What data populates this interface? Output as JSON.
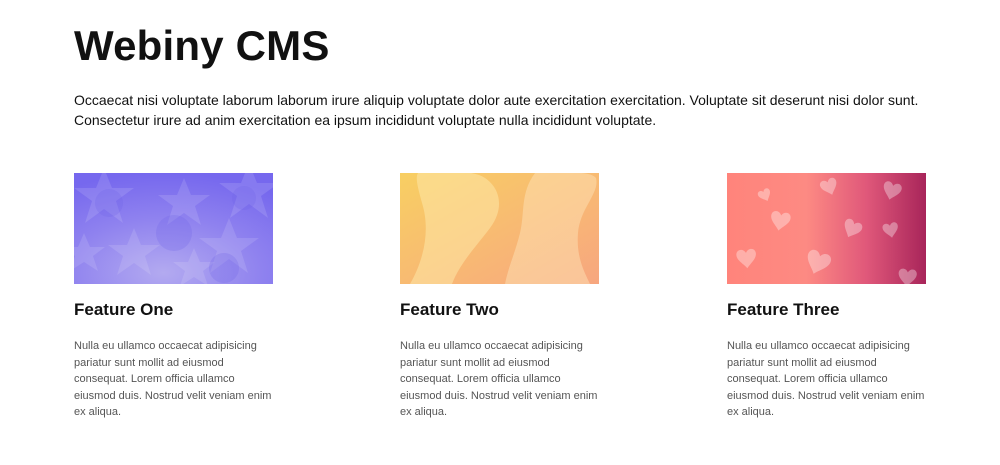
{
  "page": {
    "title": "Webiny CMS",
    "intro": "Occaecat nisi voluptate laborum laborum irure aliquip voluptate dolor aute exercitation exercitation. Voluptate sit deserunt nisi dolor sunt. Consectetur irure ad anim exercitation ea ipsum incididunt voluptate nulla incididunt voluptate."
  },
  "features": [
    {
      "title": "Feature One",
      "text": "Nulla eu ullamco occaecat adipisicing pariatur sunt mollit ad eiusmod consequat. Lorem officia ullamco eiusmod duis. Nostrud velit veniam enim ex aliqua.",
      "image": "stars-pattern-image",
      "colors": [
        "#7b6ef0",
        "#9d90f0"
      ]
    },
    {
      "title": "Feature Two",
      "text": "Nulla eu ullamco occaecat adipisicing pariatur sunt mollit ad eiusmod consequat. Lorem officia ullamco eiusmod duis. Nostrud velit veniam enim ex aliqua.",
      "image": "waves-pattern-image",
      "colors": [
        "#f7c95e",
        "#f8a97c"
      ]
    },
    {
      "title": "Feature Three",
      "text": "Nulla eu ullamco occaecat adipisicing pariatur sunt mollit ad eiusmod consequat. Lorem officia ullamco eiusmod duis. Nostrud velit veniam enim ex aliqua.",
      "image": "hearts-pattern-image",
      "colors": [
        "#ff857c",
        "#b02a5b"
      ]
    }
  ]
}
